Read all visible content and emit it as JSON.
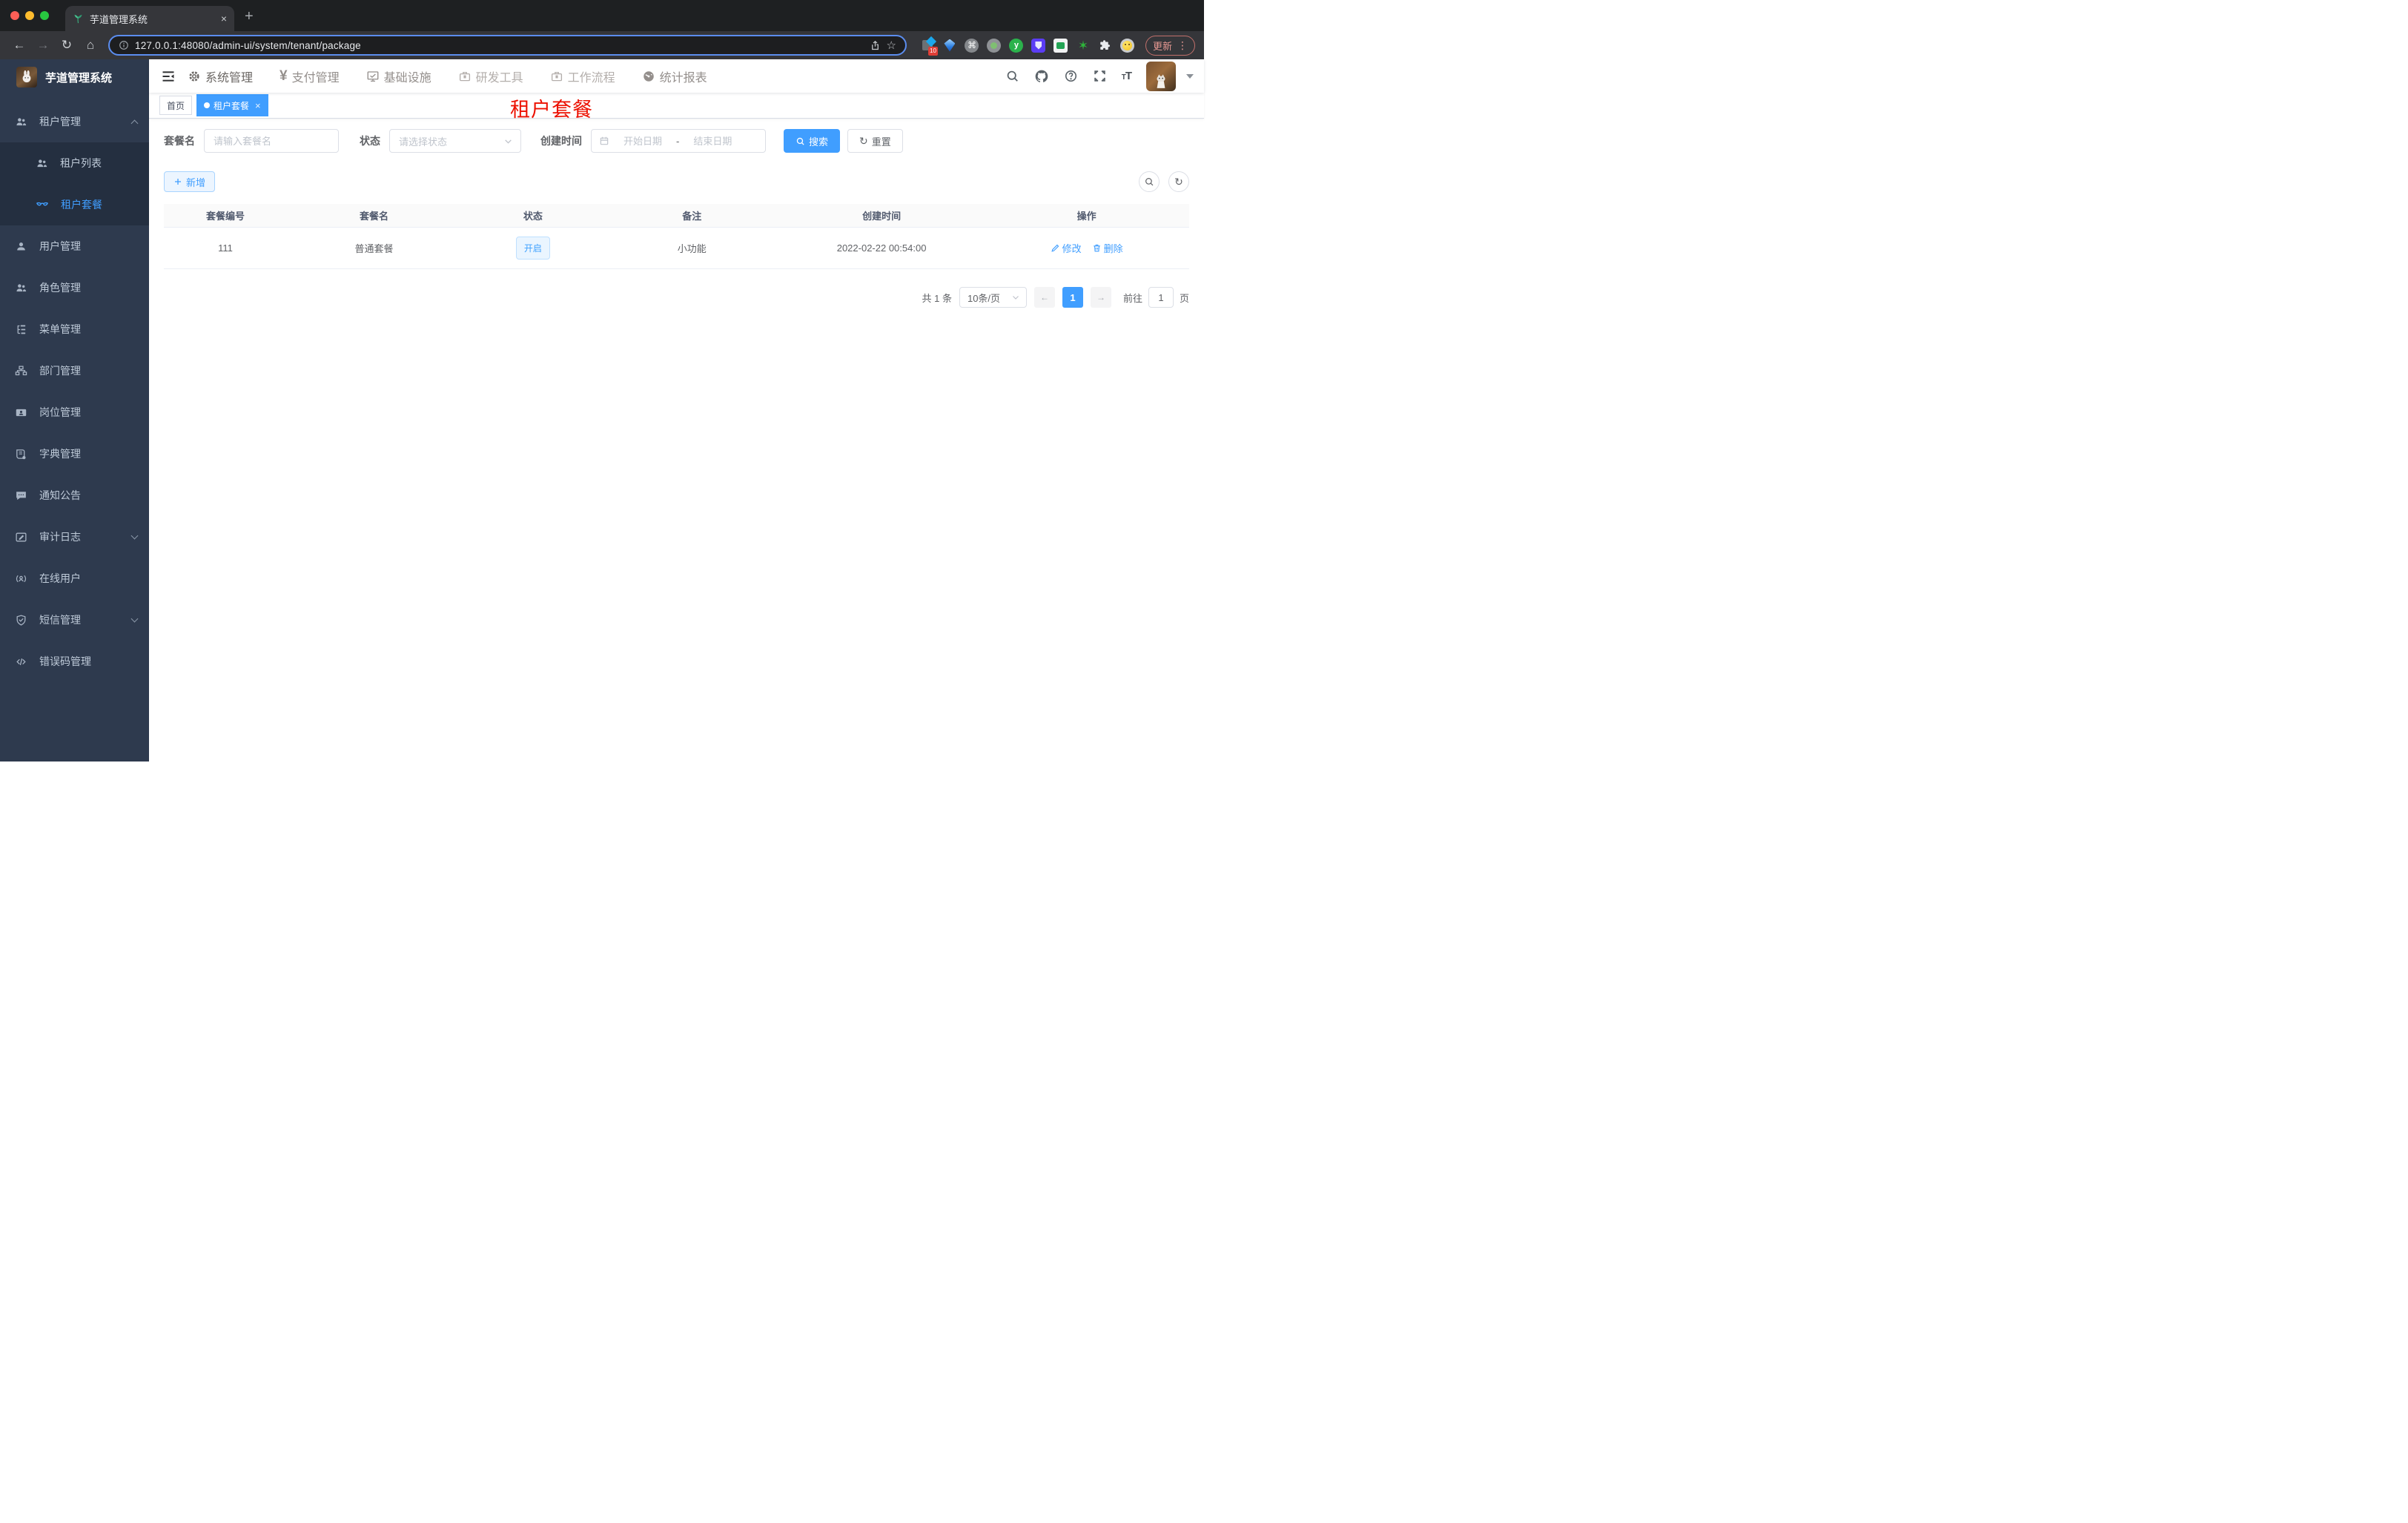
{
  "browser": {
    "tab_title": "芋道管理系统",
    "url": "127.0.0.1:48080/admin-ui/system/tenant/package",
    "update_label": "更新",
    "ext_badge": "10",
    "icons": {
      "back": "←",
      "forward": "→",
      "reload": "↻",
      "home": "⌂",
      "star": "☆",
      "command": "⌘",
      "menu_dots": "⋮",
      "tab_close": "×",
      "new_tab": "+",
      "ext_y": "y",
      "ext_star": "✶"
    }
  },
  "header": {
    "yen_glyph": "¥",
    "nav": [
      {
        "label": "系统管理"
      },
      {
        "label": "支付管理"
      },
      {
        "label": "基础设施"
      },
      {
        "label": "研发工具"
      },
      {
        "label": "工作流程"
      },
      {
        "label": "统计报表"
      }
    ]
  },
  "sidebar": {
    "logo_title": "芋道管理系统",
    "items": [
      {
        "label": "租户管理"
      },
      {
        "label": "租户列表"
      },
      {
        "label": "租户套餐"
      },
      {
        "label": "用户管理"
      },
      {
        "label": "角色管理"
      },
      {
        "label": "菜单管理"
      },
      {
        "label": "部门管理"
      },
      {
        "label": "岗位管理"
      },
      {
        "label": "字典管理"
      },
      {
        "label": "通知公告"
      },
      {
        "label": "审计日志"
      },
      {
        "label": "在线用户"
      },
      {
        "label": "短信管理"
      },
      {
        "label": "错误码管理"
      }
    ]
  },
  "tags": {
    "home": "首页",
    "active": "租户套餐"
  },
  "page": {
    "title": "租户套餐"
  },
  "filters": {
    "name_label": "套餐名",
    "name_placeholder": "请输入套餐名",
    "status_label": "状态",
    "status_placeholder": "请选择状态",
    "time_label": "创建时间",
    "start_placeholder": "开始日期",
    "range_sep": "-",
    "end_placeholder": "结束日期",
    "search_label": "搜索",
    "reset_label": "重置"
  },
  "toolbar": {
    "add_label": "新增"
  },
  "table": {
    "columns": [
      "套餐编号",
      "套餐名",
      "状态",
      "备注",
      "创建时间",
      "操作"
    ],
    "rows": [
      {
        "id": "111",
        "name": "普通套餐",
        "status": "开启",
        "remark": "小功能",
        "created": "2022-02-22 00:54:00",
        "edit": "修改",
        "delete": "删除"
      }
    ]
  },
  "pagination": {
    "total": "共 1 条",
    "page_size": "10条/页",
    "current": "1",
    "goto": "前往",
    "goto_value": "1",
    "unit": "页"
  },
  "colors": {
    "accent": "#409eff",
    "sidebar_bg": "#2e3a4e",
    "submenu_bg": "#242f40",
    "title_red": "#ec1000",
    "status_tag_bg": "#eaf5ff",
    "header_row_bg": "#fafafa"
  }
}
